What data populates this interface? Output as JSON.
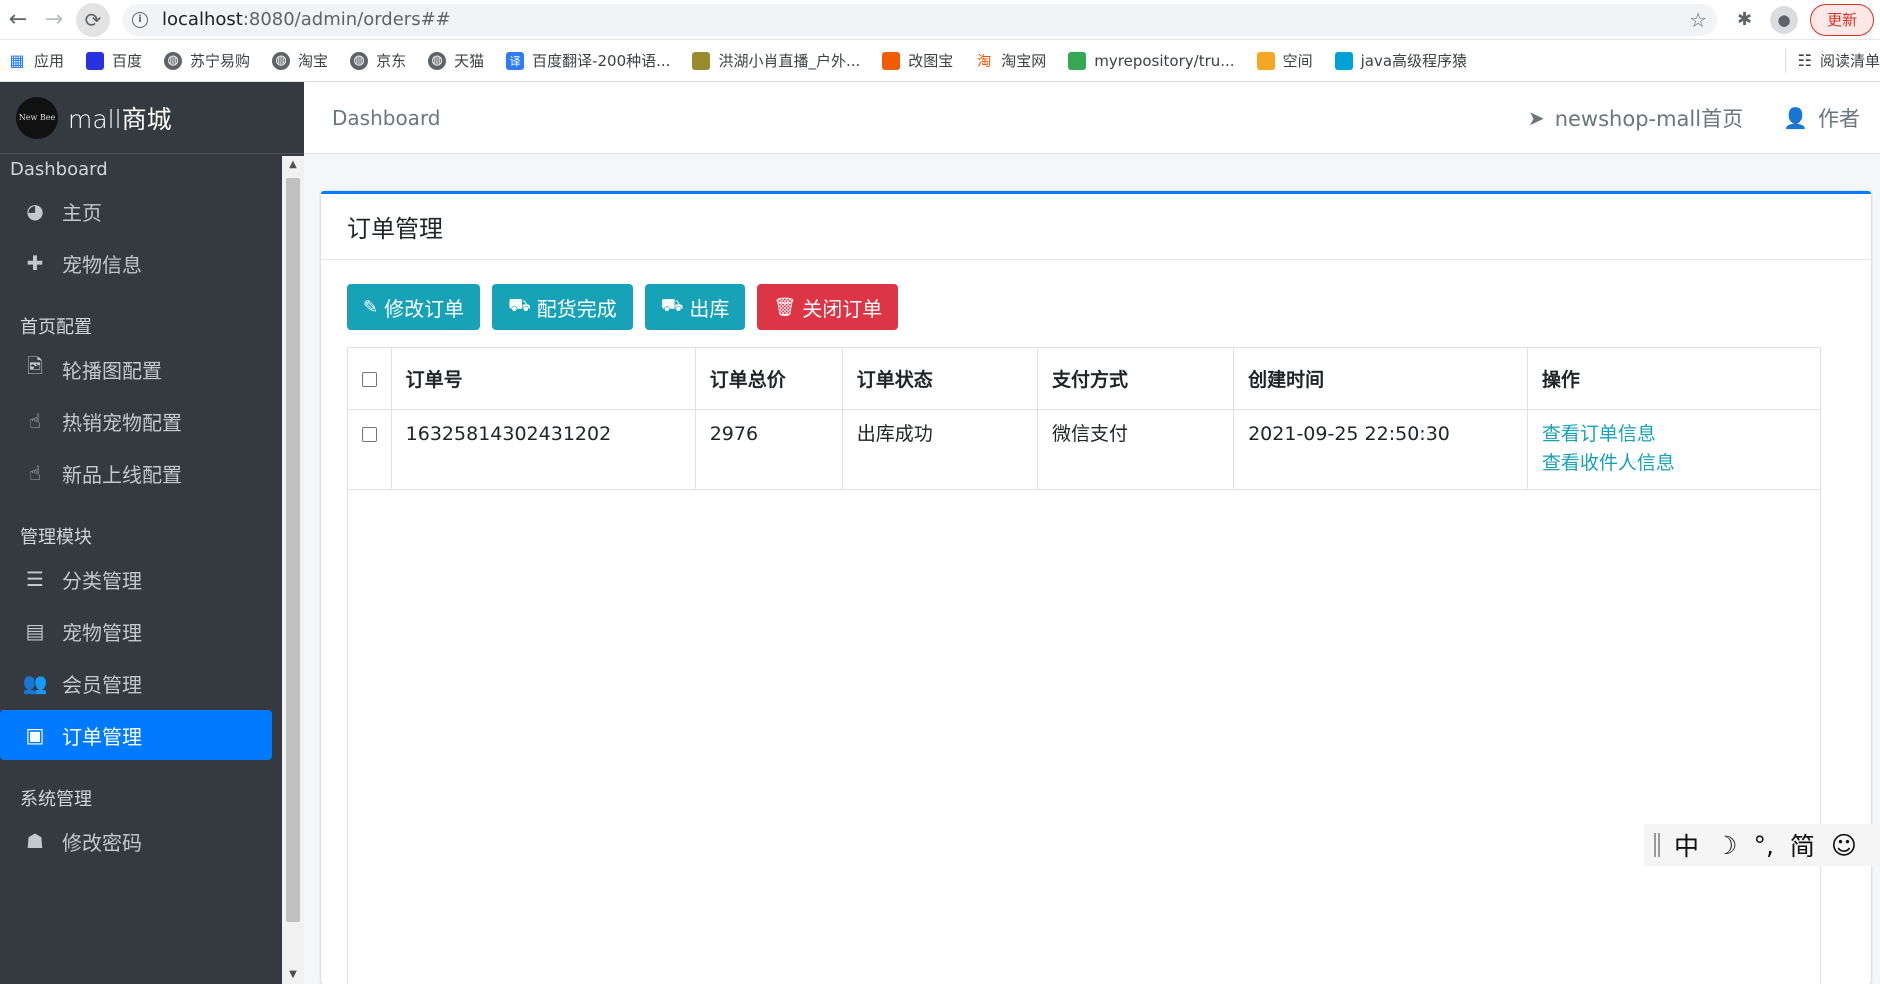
{
  "browser": {
    "url_host": "localhost",
    "url_rest": ":8080/admin/orders##",
    "update_label": "更新",
    "bookmarks": [
      {
        "label": "应用",
        "icon": "apps-grid-icon",
        "color": "#1a73e8"
      },
      {
        "label": "百度",
        "icon": "baidu-paw-icon",
        "color": "#2932e1"
      },
      {
        "label": "苏宁易购",
        "icon": "globe-icon",
        "color": "#5f6368"
      },
      {
        "label": "淘宝",
        "icon": "globe-icon",
        "color": "#5f6368"
      },
      {
        "label": "京东",
        "icon": "globe-icon",
        "color": "#5f6368"
      },
      {
        "label": "天猫",
        "icon": "globe-icon",
        "color": "#5f6368"
      },
      {
        "label": "百度翻译-200种语...",
        "icon": "translate-icon",
        "color": "#2f7cf6"
      },
      {
        "label": "洪湖小肖直播_户外...",
        "icon": "bird-icon",
        "color": "#9a8b2d"
      },
      {
        "label": "改图宝",
        "icon": "gaitubao-icon",
        "color": "#f25c05"
      },
      {
        "label": "淘宝网",
        "icon": "taobao-icon",
        "color": "#ff5000"
      },
      {
        "label": "myrepository/tru...",
        "icon": "repo-icon",
        "color": "#34a853"
      },
      {
        "label": "空间",
        "icon": "qzone-icon",
        "color": "#f5a623"
      },
      {
        "label": "java高级程序猿",
        "icon": "bilibili-icon",
        "color": "#00a1d6"
      }
    ],
    "reading_list_label": "阅读清单"
  },
  "sidebar": {
    "brand_logo_text": "New Bee",
    "brand_name": "mall商城",
    "sections": [
      {
        "header": "Dashboard",
        "items": [
          {
            "label": "主页",
            "icon": "tachometer-icon",
            "glyph": "◕"
          },
          {
            "label": "宠物信息",
            "icon": "plus-icon",
            "glyph": "✚"
          }
        ]
      },
      {
        "header": "首页配置",
        "items": [
          {
            "label": "轮播图配置",
            "icon": "image-file-icon",
            "glyph": "🖻"
          },
          {
            "label": "热销宠物配置",
            "icon": "hand-pointer-icon",
            "glyph": "☝"
          },
          {
            "label": "新品上线配置",
            "icon": "hand-pointer-icon",
            "glyph": "☝"
          }
        ]
      },
      {
        "header": "管理模块",
        "items": [
          {
            "label": "分类管理",
            "icon": "list-alt-icon",
            "glyph": "☰"
          },
          {
            "label": "宠物管理",
            "icon": "archive-icon",
            "glyph": "▤"
          },
          {
            "label": "会员管理",
            "icon": "users-icon",
            "glyph": "👥"
          },
          {
            "label": "订单管理",
            "icon": "money-bill-icon",
            "glyph": "▣",
            "active": true
          }
        ]
      },
      {
        "header": "系统管理",
        "items": [
          {
            "label": "修改密码",
            "icon": "user-secret-icon",
            "glyph": "☗"
          }
        ]
      }
    ]
  },
  "topnav": {
    "breadcrumb": "Dashboard",
    "home_link": "newshop-mall首页",
    "author_link": "作者"
  },
  "card": {
    "title": "订单管理",
    "buttons": [
      {
        "label": "修改订单",
        "glyph": "✎",
        "icon": "edit-icon",
        "style": "info"
      },
      {
        "label": "配货完成",
        "glyph": "⛟",
        "icon": "truck-icon",
        "style": "info"
      },
      {
        "label": "出库",
        "glyph": "⛟",
        "icon": "truck-icon",
        "style": "info"
      },
      {
        "label": "关闭订单",
        "glyph": "🗑",
        "icon": "trash-icon",
        "style": "danger"
      }
    ],
    "table": {
      "columns": [
        "订单号",
        "订单总价",
        "订单状态",
        "支付方式",
        "创建时间",
        "操作"
      ],
      "rows": [
        {
          "order_no": "16325814302431202",
          "total": "2976",
          "status": "出库成功",
          "pay_type": "微信支付",
          "created": "2021-09-25 22:50:30",
          "actions": [
            "查看订单信息",
            "查看收件人信息"
          ]
        }
      ]
    }
  },
  "ime": {
    "items": [
      "中",
      "☽",
      "°,",
      "简",
      "☺"
    ]
  },
  "colors": {
    "primary": "#007bff",
    "info": "#17a2b8",
    "danger": "#dc3545",
    "sidebar_bg": "#343a40"
  }
}
